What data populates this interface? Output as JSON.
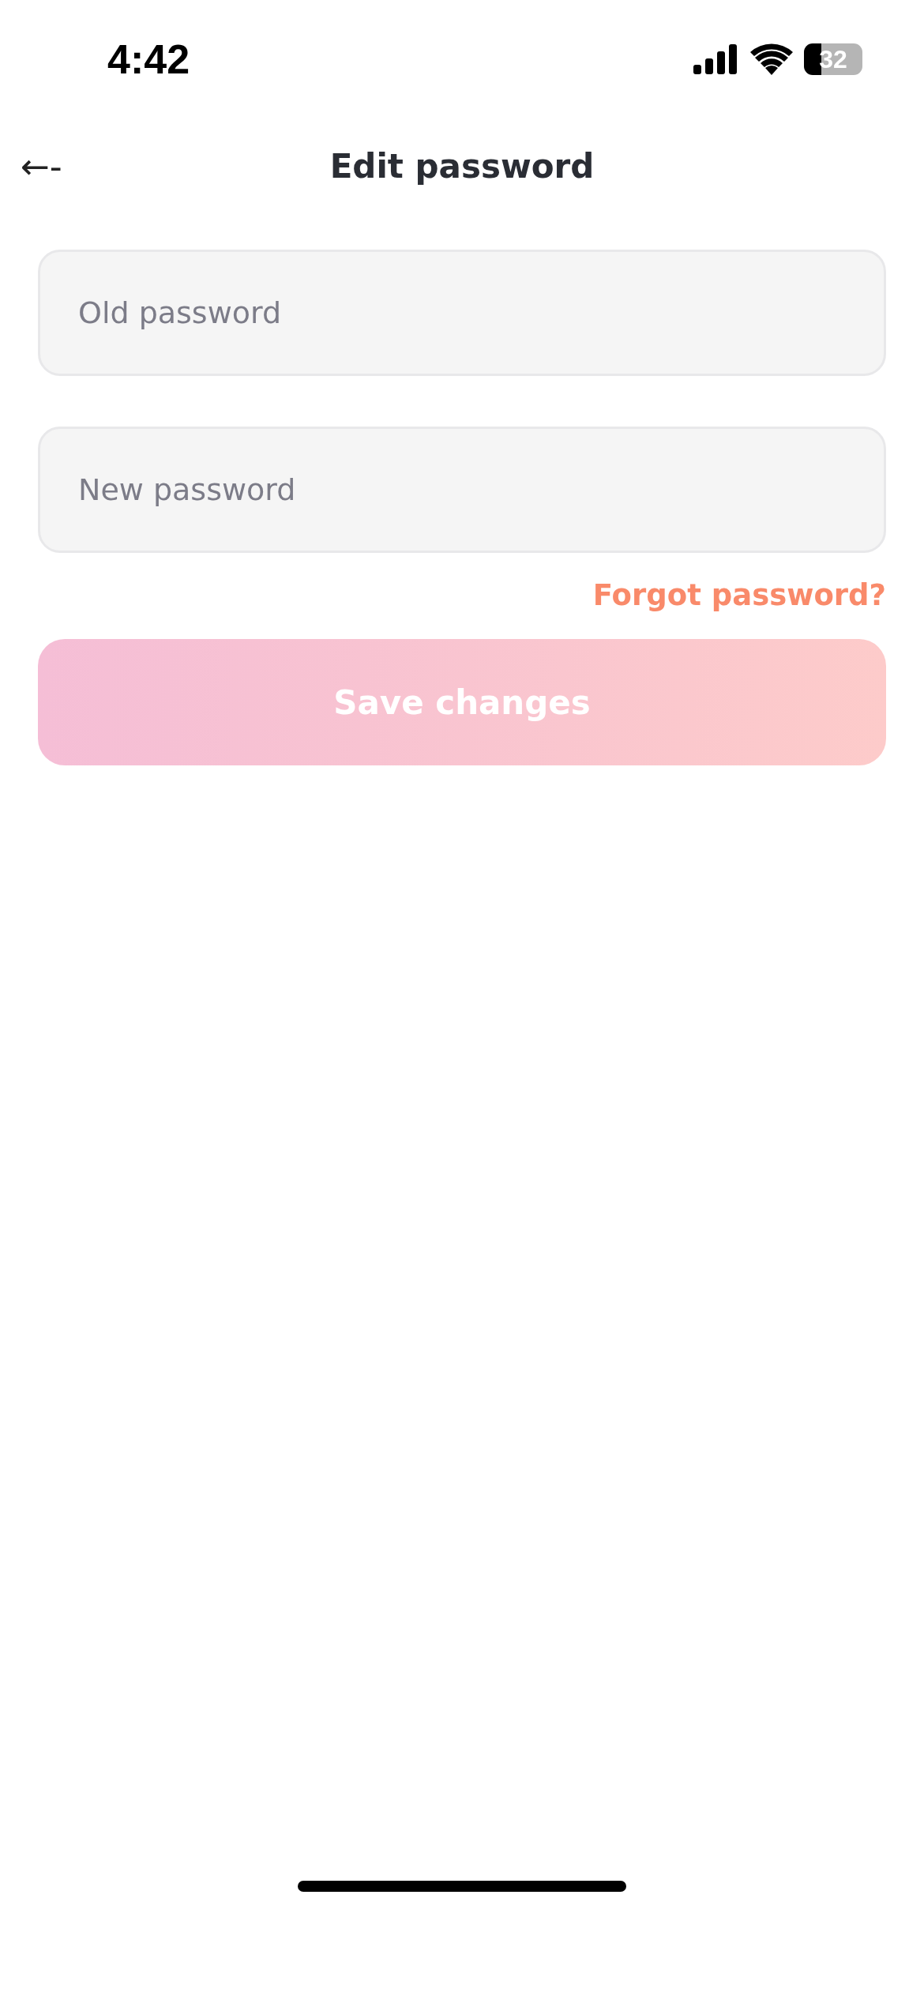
{
  "status_bar": {
    "time": "4:42",
    "battery": "32"
  },
  "header": {
    "back": "←-",
    "title": "Edit password"
  },
  "fields": [
    {
      "placeholder": "Old password"
    },
    {
      "placeholder": "New password"
    }
  ],
  "forgot_link": "Forgot password?",
  "save_button": {
    "label": "Save changes",
    "disabled": true
  }
}
